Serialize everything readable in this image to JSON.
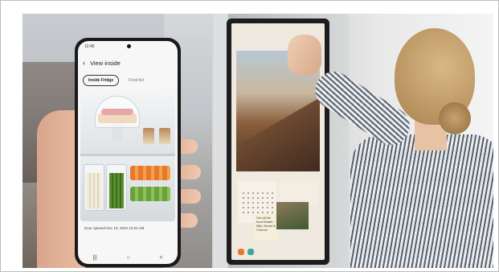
{
  "phone": {
    "status_time": "12:45",
    "screen_title": "View inside",
    "tabs": [
      {
        "label": "Inside Fridge",
        "active": true
      },
      {
        "label": "Food list",
        "active": false
      }
    ],
    "door_opened_text": "Door opened Dec 15, 2020 12:02 AM",
    "nav": [
      "|||",
      "○",
      "<"
    ]
  },
  "tablet": {
    "sticky_note": "Got all the food! Butter, Milk, Bread & Cheese"
  },
  "colors": {
    "accent_orange": "#e9782a",
    "accent_green": "#6aa13b",
    "berry_red": "#c0232b"
  }
}
